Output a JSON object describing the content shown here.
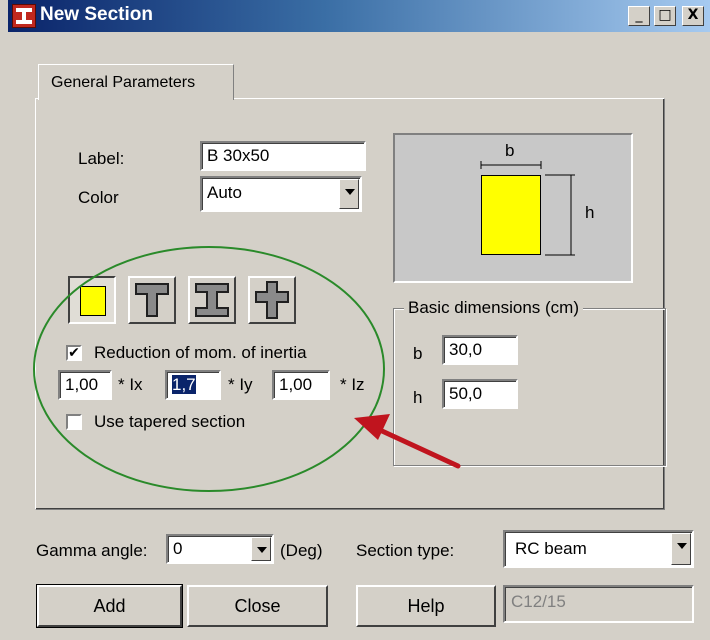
{
  "window": {
    "title": "New Section",
    "controls": {
      "minimize": "_",
      "maximize": "□",
      "close": "X"
    }
  },
  "tabs": [
    {
      "label": "General Parameters"
    }
  ],
  "form": {
    "label_caption": "Label:",
    "label_value": "B 30x50",
    "color_caption": "Color",
    "color_value": "Auto"
  },
  "preview": {
    "b_label": "b",
    "h_label": "h",
    "fill_color": "#ffff00"
  },
  "shapes": [
    {
      "name": "rectangle",
      "selected": true
    },
    {
      "name": "t-section",
      "selected": false
    },
    {
      "name": "i-section",
      "selected": false
    },
    {
      "name": "cross-section",
      "selected": false
    }
  ],
  "inertia": {
    "reduction_label": "Reduction of mom. of inertia",
    "reduction_checked": true,
    "check_mark": "✔",
    "ix_value": "1,00",
    "ix_suffix": "* Ix",
    "iy_value": "1,7",
    "iy_suffix": "* Iy",
    "iz_value": "1,00",
    "iz_suffix": "* Iz",
    "tapered_label": "Use tapered section",
    "tapered_checked": false
  },
  "basic_dimensions": {
    "title": "Basic dimensions (cm)",
    "b_caption": "b",
    "b_value": "30,0",
    "h_caption": "h",
    "h_value": "50,0"
  },
  "bottom": {
    "gamma_caption": "Gamma angle:",
    "gamma_value": "0",
    "gamma_unit": "(Deg)",
    "section_type_caption": "Section type:",
    "section_type_value": "RC beam",
    "material_value": "C12/15"
  },
  "buttons": {
    "add": "Add",
    "close": "Close",
    "help": "Help"
  },
  "annotations": {
    "ellipse_color": "#2a8a2a",
    "arrow_color": "#c0141e"
  }
}
